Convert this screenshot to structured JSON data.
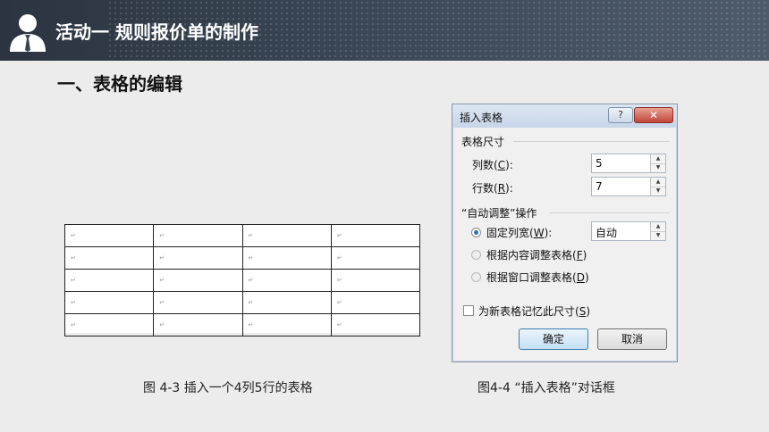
{
  "header": {
    "title": "活动一  规则报价单的制作"
  },
  "section": {
    "title": "一、表格的编辑"
  },
  "doc_table": {
    "rows": [
      [
        "↵",
        "↵",
        "↵",
        "↵"
      ],
      [
        "↵",
        "↵",
        "↵",
        "↵"
      ],
      [
        "↵",
        "↵",
        "↵",
        "↵"
      ],
      [
        "↵",
        "↵",
        "↵",
        "↵"
      ],
      [
        "↵",
        "↵",
        "↵",
        "↵"
      ]
    ]
  },
  "dialog": {
    "title": "插入表格",
    "help_glyph": "?",
    "close_glyph": "✕",
    "size_group": "表格尺寸",
    "columns_label_pre": "列数(",
    "columns_mnemonic": "C",
    "columns_label_post": "):",
    "columns_value": "5",
    "rows_label_pre": "行数(",
    "rows_mnemonic": "R",
    "rows_label_post": "):",
    "rows_value": "7",
    "autofit_group": "“自动调整”操作",
    "fixed_pre": "固定列宽(",
    "fixed_mnemonic": "W",
    "fixed_post": "):",
    "fixed_value": "自动",
    "content_pre": "根据内容调整表格(",
    "content_mnemonic": "F",
    "content_post": ")",
    "window_pre": "根据窗口调整表格(",
    "window_mnemonic": "D",
    "window_post": ")",
    "remember_pre": "为新表格记忆此尺寸(",
    "remember_mnemonic": "S",
    "remember_post": ")",
    "ok_label": "确定",
    "cancel_label": "取消"
  },
  "captions": {
    "left": "图 4-3  插入一个4列5行的表格",
    "right": "图4-4  “插入表格”对话框"
  }
}
